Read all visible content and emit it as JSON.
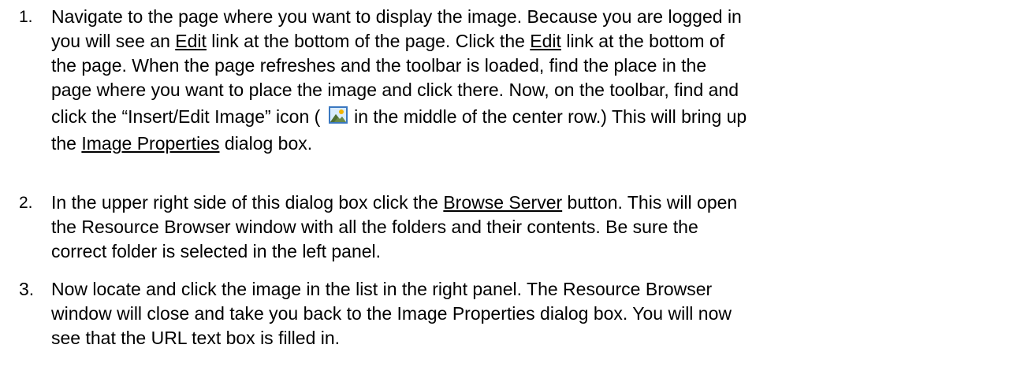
{
  "steps": [
    {
      "number": "1.",
      "lines": [
        [
          "Navigate to the page where you want to display the image. Because you are logged in"
        ],
        [
          "you will see an ",
          "Edit",
          " link at the bottom of the page. Click the ",
          "Edit",
          " link at the bottom of"
        ],
        [
          "the page. When the page refreshes and the toolbar is loaded, find the place in the"
        ],
        [
          "page where you want to place the image and click there. Now, on the toolbar, find and"
        ],
        [
          "click the “Insert/Edit Image” icon ( ",
          " in the middle of the center row.) This will bring up"
        ],
        [
          "the ",
          "Image Properties",
          " dialog box."
        ]
      ],
      "icon": "insert-image-icon"
    },
    {
      "number": "2.",
      "lines": [
        [
          "In the upper right side of this dialog box click the ",
          "Browse Server",
          " button. This will open"
        ],
        [
          "the Resource Browser window with all the folders and their contents. Be sure the"
        ],
        [
          "correct folder is selected in the left panel."
        ]
      ]
    },
    {
      "number": "3.",
      "lines": [
        [
          "Now locate and click the image in the list in the right panel. The Resource Browser"
        ],
        [
          "window will close and take you back to the Image Properties dialog box. You will now"
        ],
        [
          "see that the URL text box is filled in."
        ]
      ]
    }
  ],
  "colors": {
    "text": "#000000",
    "background": "#ffffff",
    "icon_frame": "#3a78c0",
    "icon_sky": "#d9ecff",
    "icon_hill": "#6a8a4a",
    "icon_sun": "#f2b400"
  }
}
